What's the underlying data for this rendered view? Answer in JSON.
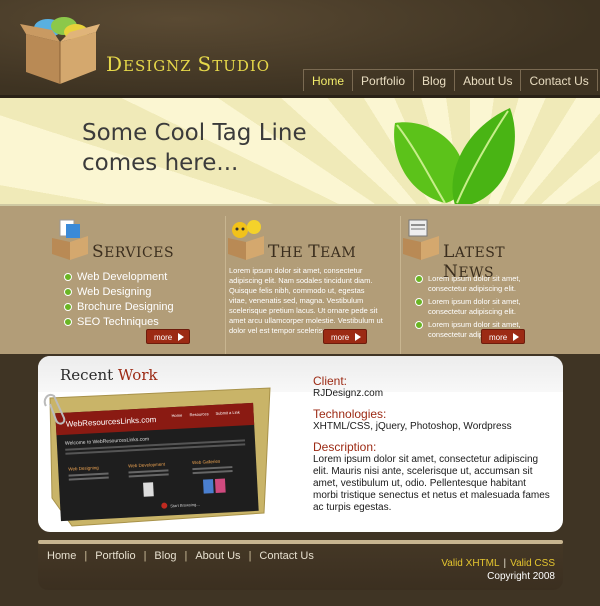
{
  "brand": {
    "name_big_d": "D",
    "name_rest1": "ESIGNZ ",
    "name_big_s": "S",
    "name_rest2": "TUDIO"
  },
  "nav": [
    "Home",
    "Portfolio",
    "Blog",
    "About Us",
    "Contact Us"
  ],
  "banner": {
    "line1": "Some Cool Tag Line",
    "line2": "comes here..."
  },
  "services": {
    "title_cap": "S",
    "title_rest": "ERVICES",
    "items": [
      "Web Development",
      "Web Designing",
      "Brochure Designing",
      "SEO Techniques"
    ],
    "more": "more"
  },
  "team": {
    "title_cap": "T",
    "title_rest": "HE ",
    "title_cap2": "T",
    "title_rest2": "EAM",
    "text": "Lorem ipsum dolor sit amet, consectetur adipiscing elit. Nam sodales tincidunt diam. Quisque felis nibh, commodo ut, egestas vitae, venenatis sed, magna. Vestibulum scelerisque pretium lacus. Ut ornare pede sit amet arcu ullamcorper molestie. Vestibulum ut dolor vel est tempor scelerisque.",
    "more": "more"
  },
  "news": {
    "title_cap": "L",
    "title_rest": "ATEST ",
    "title_cap2": "N",
    "title_rest2": "EWS",
    "items": [
      "Lorem ipsum dolor sit amet, consectetur adipiscing elit.",
      "Lorem ipsum dolor sit amet, consectetur adipiscing elit.",
      "Lorem ipsum dolor sit amet, consectetur adipiscing elit."
    ],
    "more": "more"
  },
  "recent_work": {
    "title_a": "Recent ",
    "title_b": "Work",
    "client_label": "Client:",
    "client": "RJDesignz.com",
    "tech_label": "Technologies:",
    "tech": "XHTML/CSS, jQuery, Photoshop, Wordpress",
    "desc_label": "Description:",
    "desc": "Lorem ipsum dolor sit amet, consectetur adipiscing elit. Mauris nisi ante, scelerisque ut, accumsan sit amet, vestibulum ut, odio. Pellentesque habitant morbi tristique senectus et netus et malesuada fames ac turpis egestas.",
    "shot_site": "WebResourcesLinks.com",
    "shot_nav": [
      "Home",
      "Resources",
      "Submit a Link"
    ],
    "shot_welcome": "Welcome to WebResourcesLinks.com",
    "shot_cols": [
      "Web Designing",
      "Web Development",
      "Web Galleries"
    ],
    "shot_btn": "Start Browsing..."
  },
  "footer": {
    "links": [
      "Home",
      "Portfolio",
      "Blog",
      "About Us",
      "Contact Us"
    ],
    "valid_xhtml": "Valid XHTML",
    "valid_css": "Valid CSS",
    "copyright": "Copyright 2008"
  },
  "colors": {
    "accent": "#9c2a14",
    "logo": "#e6d84a",
    "green": "#6ab524"
  }
}
